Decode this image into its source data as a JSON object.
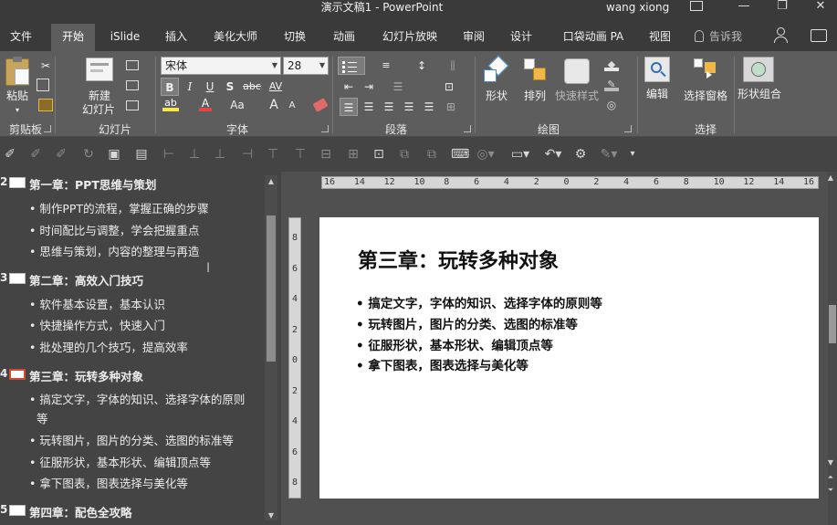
{
  "window": {
    "title": "演示文稿1  -  PowerPoint",
    "user": "wang xiong",
    "minimize_glyph": "—",
    "restore_glyph": "❐",
    "close_glyph": "✕"
  },
  "tabs": [
    "文件",
    "开始",
    "iSlide",
    "插入",
    "美化大师",
    "切换",
    "动画",
    "幻灯片放映",
    "审阅",
    "设计",
    "口袋动画 PA",
    "视图"
  ],
  "active_tab": "开始",
  "tell_me": "告诉我",
  "ribbon": {
    "clipboard": {
      "group": "剪贴板",
      "paste": "粘贴"
    },
    "slides": {
      "group": "幻灯片",
      "new_slide_line1": "新建",
      "new_slide_line2": "幻灯片"
    },
    "font": {
      "group": "字体",
      "font_name": "宋体",
      "font_size": "28",
      "bold": "B",
      "italic": "I",
      "underline": "U",
      "shadow": "S",
      "strike": "abc",
      "spacing": "AV",
      "case": "Aa",
      "grow": "A",
      "shrink": "A"
    },
    "paragraph": {
      "group": "段落"
    },
    "drawing": {
      "group": "绘图",
      "shape": "形状",
      "arrange": "排列",
      "quick_style": "快速样式"
    },
    "editing": {
      "label": "编辑"
    },
    "select": {
      "group": "选择",
      "selection_pane": "选择窗格"
    },
    "shape_combine": {
      "label": "形状组合"
    }
  },
  "outline": [
    {
      "num": "2",
      "title": "第一章：PPT思维与策划",
      "selected": false,
      "bullets": [
        "制作PPT的流程，掌握正确的步骤",
        "时间配比与调整，学会把握重点",
        "思维与策划，内容的整理与再造"
      ]
    },
    {
      "num": "3",
      "title": "第二章：高效入门技巧",
      "selected": false,
      "bullets": [
        "软件基本设置，基本认识",
        "快捷操作方式，快速入门",
        "批处理的几个技巧，提高效率"
      ]
    },
    {
      "num": "4",
      "title": "第三章：玩转多种对象",
      "selected": true,
      "bullets": [
        "搞定文字，字体的知识、选择字体的原则",
        "等",
        "玩转图片，图片的分类、选图的标准等",
        "征服形状，基本形状、编辑顶点等",
        "拿下图表，图表选择与美化等"
      ]
    },
    {
      "num": "5",
      "title": "第四章：配色全攻略",
      "selected": false,
      "bullets": []
    }
  ],
  "slide": {
    "title": "第三章：玩转多种对象",
    "bullets": [
      "搞定文字，字体的知识、选择字体的原则等",
      "玩转图片，图片的分类、选图的标准等",
      "征服形状，基本形状、编辑顶点等",
      "拿下图表，图表选择与美化等"
    ]
  },
  "hruler_ticks": [
    "16",
    "14",
    "12",
    "10",
    "8",
    "6",
    "4",
    "2",
    "0",
    "2",
    "4",
    "6",
    "8",
    "10",
    "12",
    "14",
    "16"
  ],
  "vruler_ticks": [
    "8",
    "6",
    "4",
    "2",
    "0",
    "2",
    "4",
    "6",
    "8"
  ]
}
